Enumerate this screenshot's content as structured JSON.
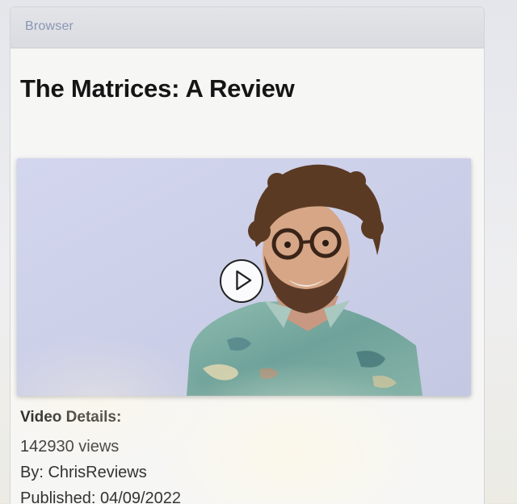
{
  "window": {
    "app_name": "Browser"
  },
  "video": {
    "title": "The Matrices: A Review",
    "thumbnail_icon": "person-portrait-icon",
    "play_icon": "play-icon"
  },
  "details": {
    "heading": "Video Details:",
    "views": "142930 views",
    "author": "By: ChrisReviews",
    "published": "Published: 04/09/2022"
  }
}
